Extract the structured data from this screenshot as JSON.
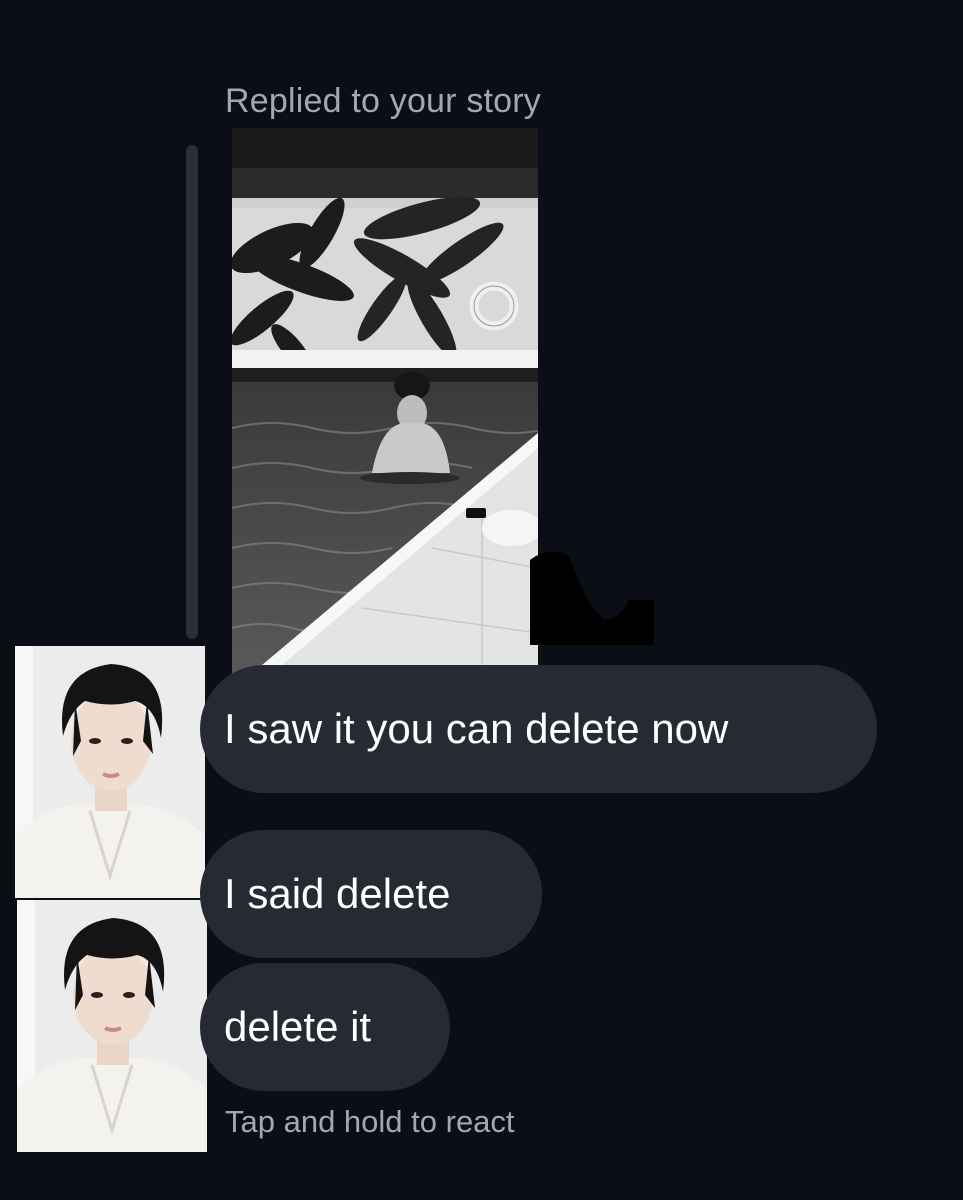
{
  "thread": {
    "reply_label": "Replied to your story",
    "story": {
      "image_name": "story-pool-photo",
      "style": "black-and-white"
    },
    "messages": [
      {
        "text": "I saw it you can delete now"
      },
      {
        "text": "I said delete"
      },
      {
        "text": "delete it"
      }
    ],
    "react_hint": "Tap and hold to react"
  },
  "theme": {
    "background": "#0b0e14",
    "bubble": "#262a33",
    "text": "#ffffff",
    "muted_text": "#a3a7b1",
    "reply_bar": "#2a2f39"
  }
}
